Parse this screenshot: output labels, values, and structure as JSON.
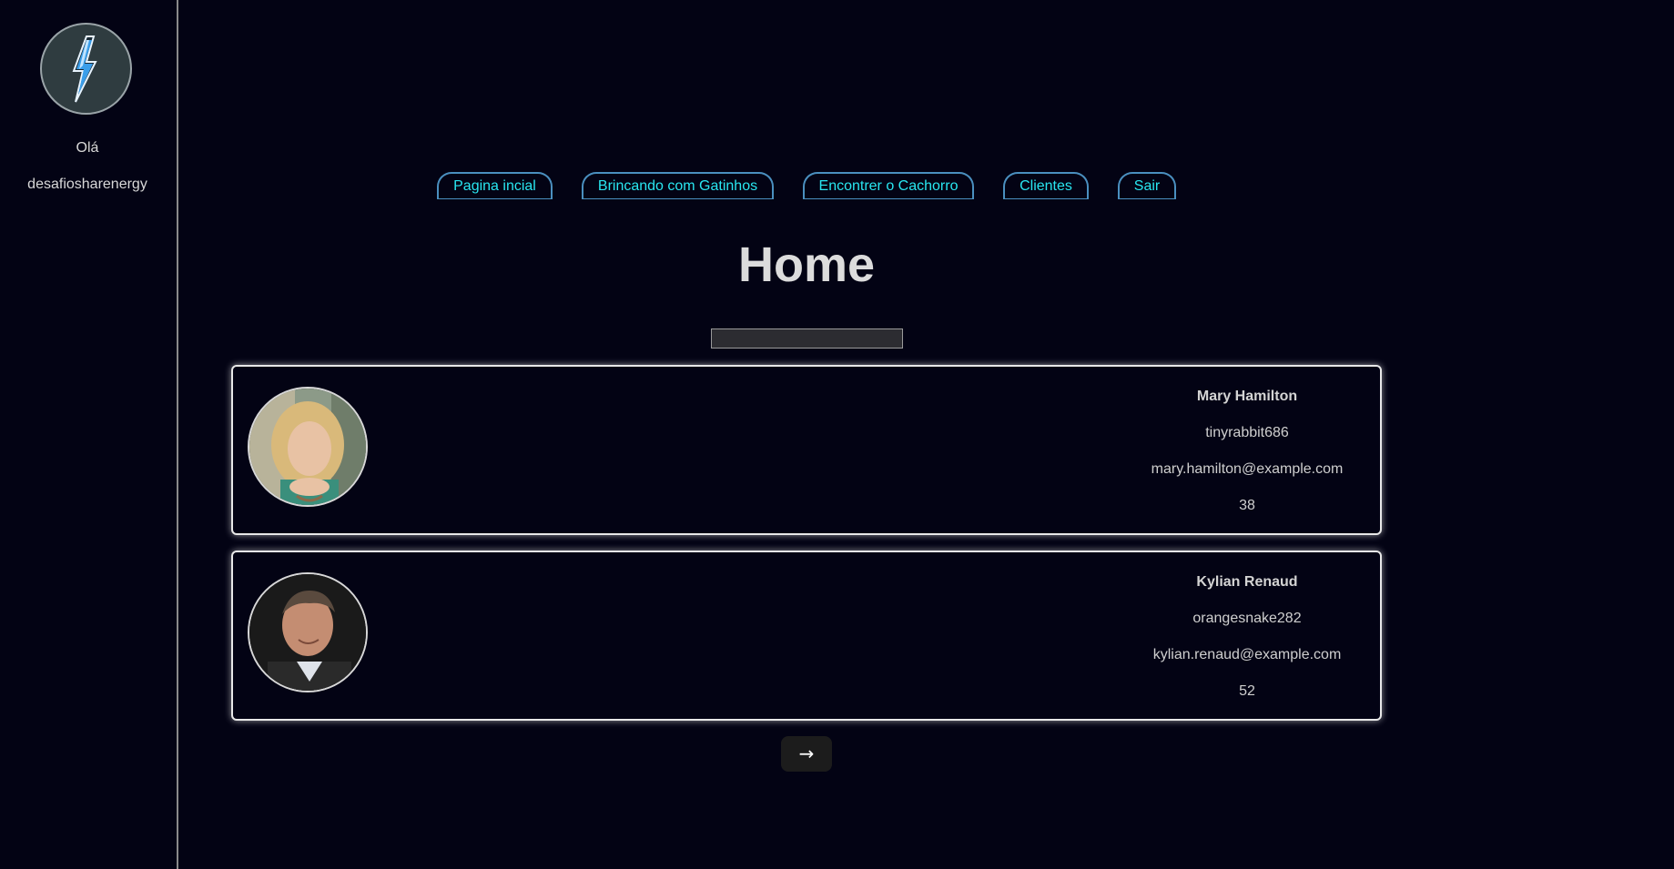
{
  "sidebar": {
    "logo_icon": "lightning-bolt-icon",
    "greeting": "Olá",
    "username": "desafiosharenergy"
  },
  "nav": {
    "items": [
      {
        "label": "Pagina incial"
      },
      {
        "label": "Brincando com Gatinhos"
      },
      {
        "label": "Encontrer o Cachorro"
      },
      {
        "label": "Clientes"
      },
      {
        "label": "Sair"
      }
    ]
  },
  "page": {
    "title": "Home"
  },
  "search": {
    "value": "",
    "placeholder": ""
  },
  "users": [
    {
      "name": "Mary Hamilton",
      "username": "tinyrabbit686",
      "email": "mary.hamilton@example.com",
      "age": "38"
    },
    {
      "name": "Kylian Renaud",
      "username": "orangesnake282",
      "email": "kylian.renaud@example.com",
      "age": "52"
    }
  ],
  "pagination": {
    "next_label": "→"
  },
  "colors": {
    "background": "#030314",
    "nav_text": "#29e6f0",
    "nav_border": "#4a8fbf"
  }
}
